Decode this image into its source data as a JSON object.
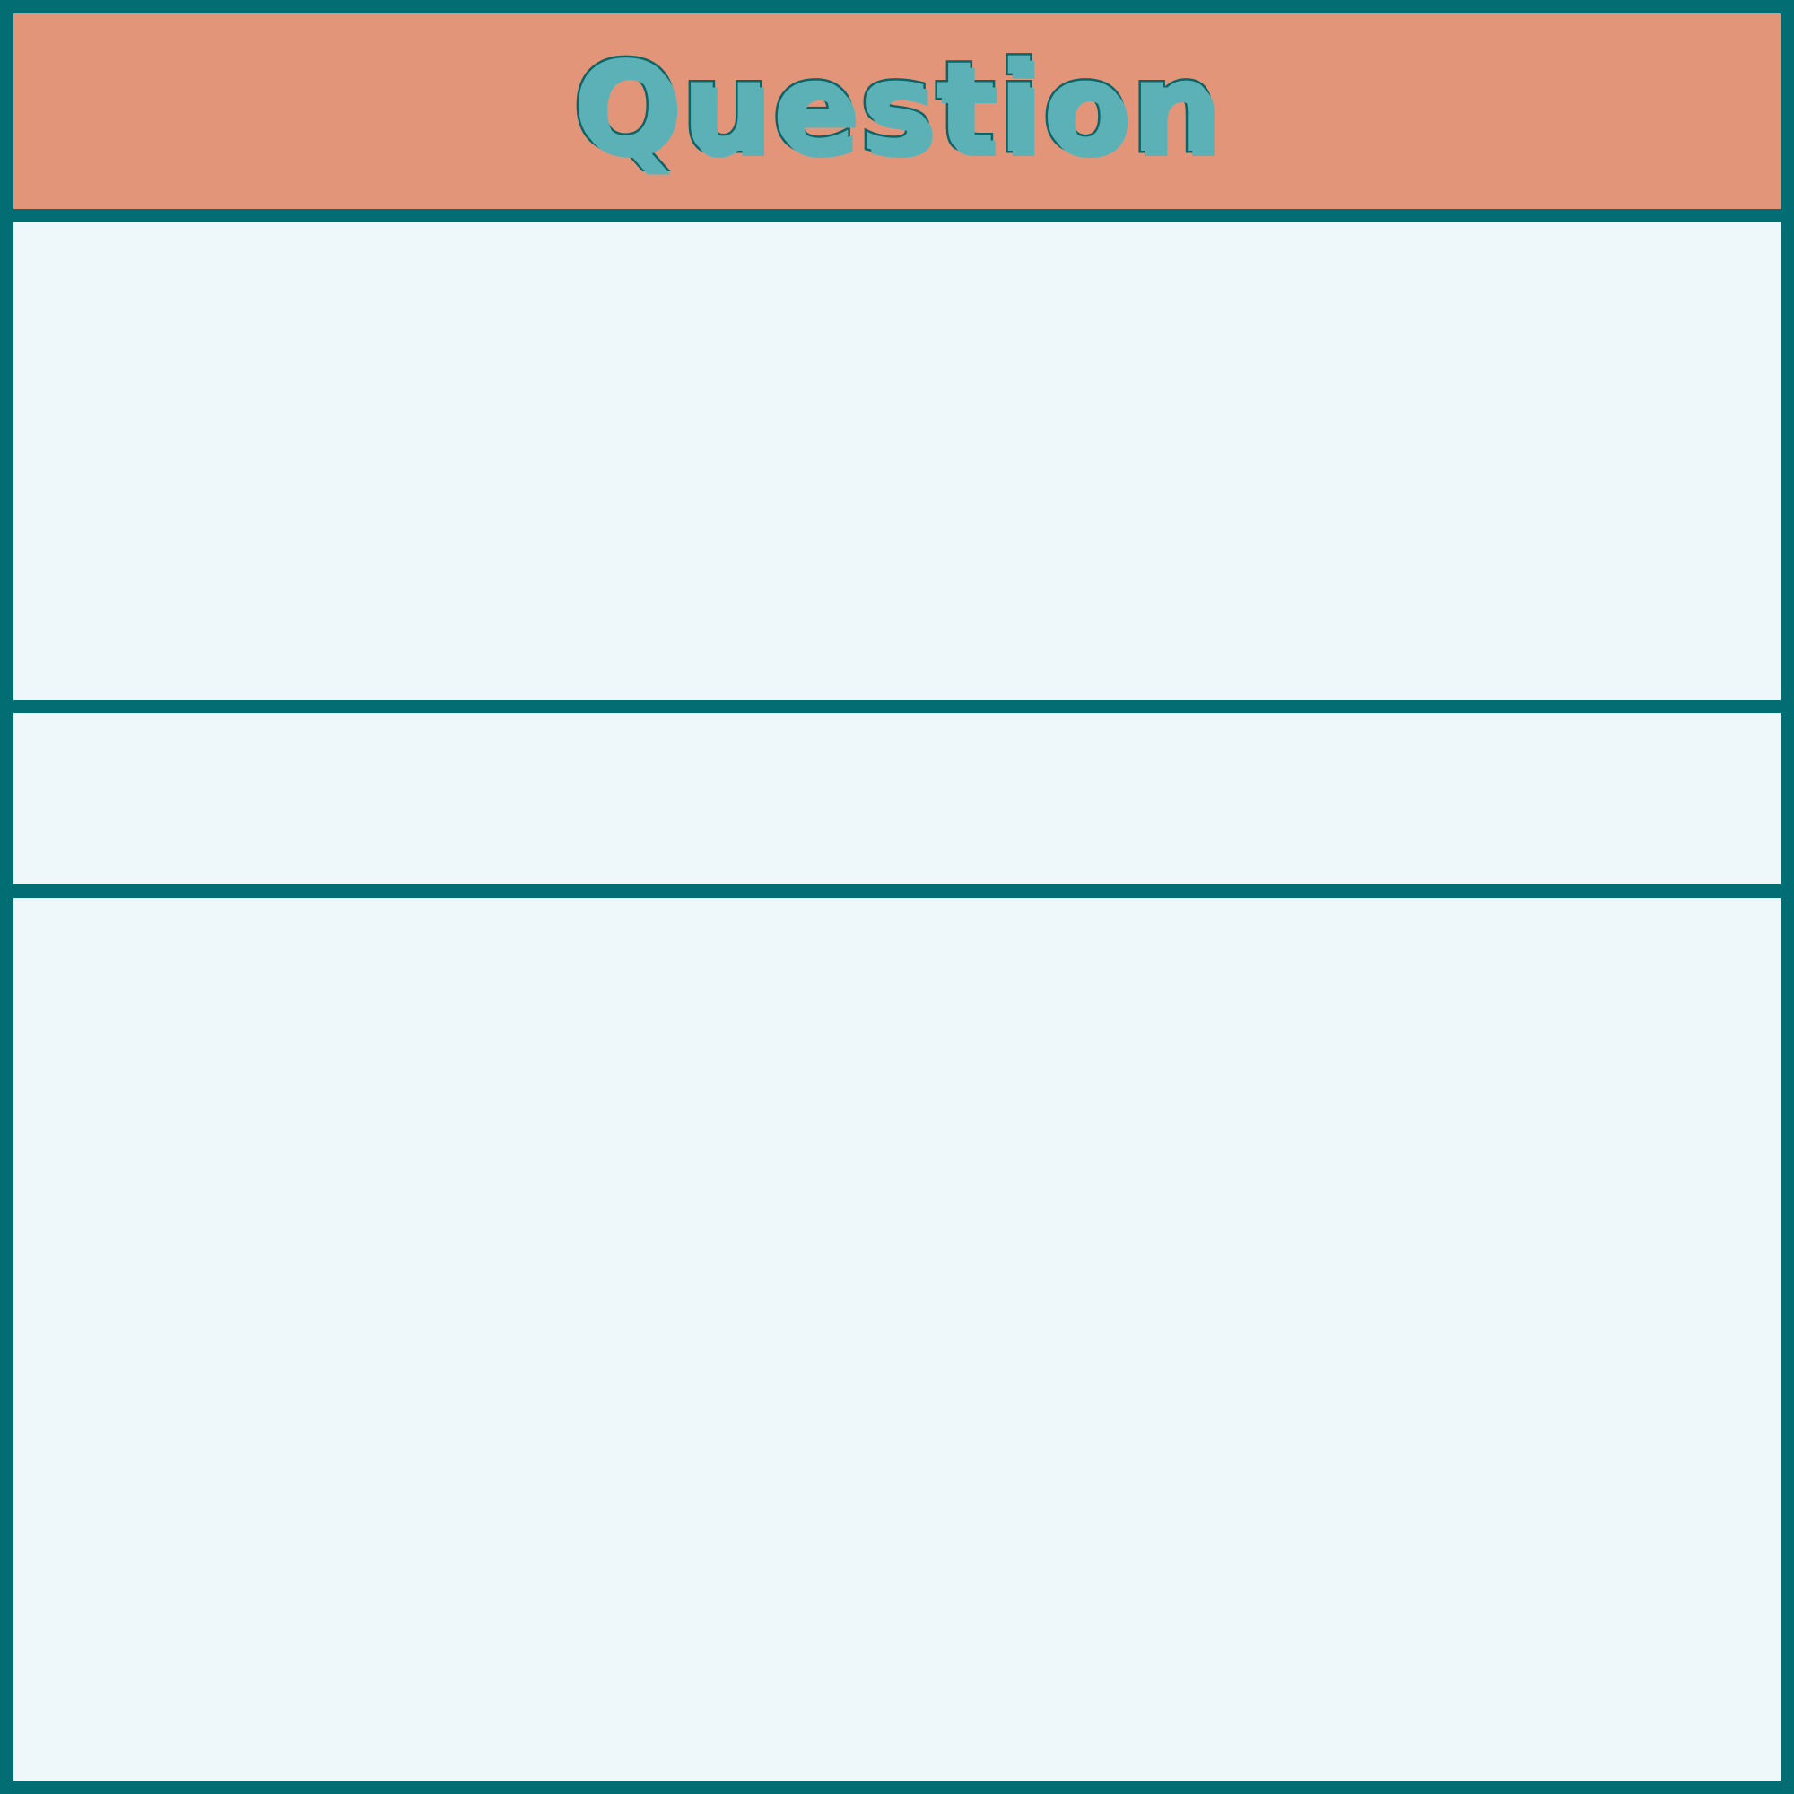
{
  "header": {
    "title": "Question"
  },
  "colors": {
    "frame": "#026e74",
    "header_background": "#e3957a",
    "title_fill": "#5bb1b6",
    "title_outline": "#0b6468",
    "panel_background": "#eef7f9"
  }
}
